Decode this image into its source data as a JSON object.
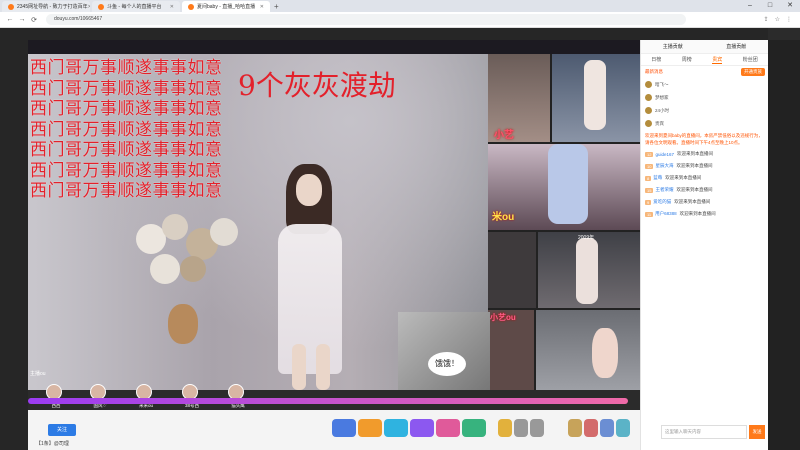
{
  "browser": {
    "tabs": [
      {
        "title": "2345网址导航 - 致力于打造百年",
        "active": false
      },
      {
        "title": "斗鱼 - 每个人的直播平台",
        "active": false
      },
      {
        "title": "夏间baby - 直播_哈哈直播",
        "active": true
      }
    ],
    "url": "douyu.com/10665467"
  },
  "overlay": {
    "lines": [
      "西门哥万事顺遂事事如意",
      "西门哥万事顺遂事事如意",
      "西门哥万事顺遂事事如意",
      "西门哥万事顺遂事事如意",
      "西门哥万事顺遂事事如意",
      "西门哥万事顺遂事事如意",
      "西门哥万事顺遂事事如意"
    ],
    "big_text": "9个灰灰渡劫"
  },
  "mini_streams": {
    "label_1": "小艺",
    "label_2": "米ou",
    "label_3": "2009年",
    "label_4": "小艺ou",
    "cat_text": "饿饿！"
  },
  "guests": [
    {
      "name": "西西"
    },
    {
      "name": "国风♡"
    },
    {
      "name": "米米ou"
    },
    {
      "name": "38号西"
    },
    {
      "name": "猫头鹰"
    }
  ],
  "guest_top_label": "主播ou",
  "bottom": {
    "chat_line": "【1条】@司理"
  },
  "sidebar": {
    "top": [
      "主播贡献",
      "直播贡献"
    ],
    "tabs": [
      "日榜",
      "周榜",
      "贵宾",
      "粉丝团"
    ],
    "notice": "最新消息",
    "open_btn": "开通贵族",
    "ranks": [
      {
        "name": "暗飞～"
      },
      {
        "name": "梦想家"
      },
      {
        "name": "24小时"
      },
      {
        "name": "贵宾"
      }
    ],
    "intro": "欢迎来到夏间baby的直播间，本房严禁低俗以及违规行为，请各位文明观看。直播时间下午4点至晚上10点。",
    "messages": [
      {
        "lv": "12",
        "name": "guide167",
        "text": "欢迎来到本直播间"
      },
      {
        "lv": "10",
        "name": "星辰大海",
        "text": "欢迎来到本直播间"
      },
      {
        "lv": "8",
        "name": "蓝莓",
        "text": "欢迎来到本直播间"
      },
      {
        "lv": "15",
        "name": "王者荣耀",
        "text": "欢迎来到本直播间"
      },
      {
        "lv": "9",
        "name": "爱吃的猫",
        "text": "欢迎来到本直播间"
      },
      {
        "lv": "11",
        "name": "用户68388",
        "text": "欢迎来到本直播间"
      }
    ],
    "input_placeholder": "这里输入聊天内容",
    "send_label": "发送"
  }
}
